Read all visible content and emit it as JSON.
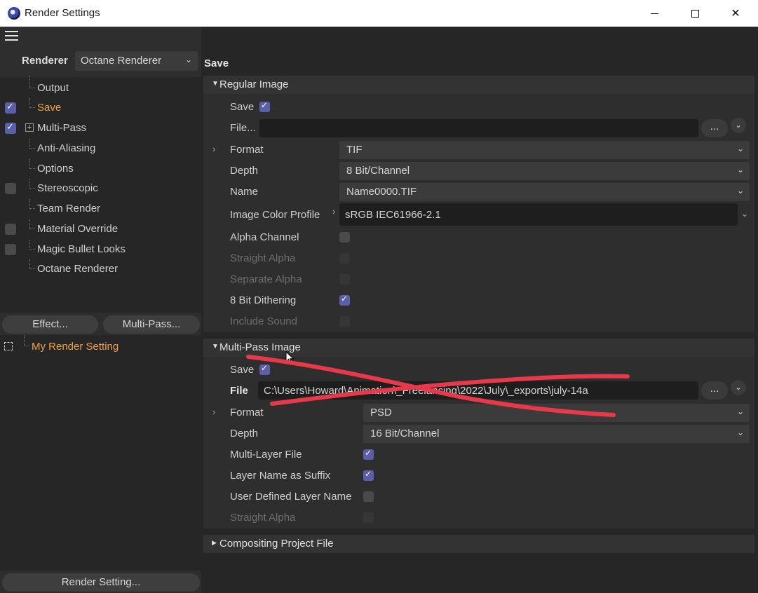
{
  "window": {
    "title": "Render Settings",
    "icon": "cinema4d-app-icon"
  },
  "renderer": {
    "label": "Renderer",
    "value": "Octane Renderer"
  },
  "tree": [
    {
      "label": "Output",
      "checkbox": "none",
      "active": false
    },
    {
      "label": "Save",
      "checkbox": "checked",
      "active": true
    },
    {
      "label": "Multi-Pass",
      "checkbox": "checked",
      "active": false,
      "expandable": true
    },
    {
      "label": "Anti-Aliasing",
      "checkbox": "none",
      "active": false
    },
    {
      "label": "Options",
      "checkbox": "none",
      "active": false
    },
    {
      "label": "Stereoscopic",
      "checkbox": "unchecked",
      "active": false
    },
    {
      "label": "Team Render",
      "checkbox": "none",
      "active": false
    },
    {
      "label": "Material Override",
      "checkbox": "unchecked",
      "active": false
    },
    {
      "label": "Magic Bullet Looks",
      "checkbox": "unchecked",
      "active": false
    },
    {
      "label": "Octane Renderer",
      "checkbox": "none",
      "active": false
    }
  ],
  "buttons": {
    "effect": "Effect...",
    "multipass": "Multi-Pass...",
    "render_setting": "Render Setting..."
  },
  "render_settings_list": [
    "My Render Setting"
  ],
  "page_title": "Save",
  "regular_image": {
    "title": "Regular Image",
    "save_label": "Save",
    "save_checked": true,
    "file_label": "File...",
    "file_value": "",
    "dots": "...",
    "format_label": "Format",
    "format_value": "TIF",
    "depth_label": "Depth",
    "depth_value": "8 Bit/Channel",
    "name_label": "Name",
    "name_value": "Name0000.TIF",
    "color_profile_label": "Image Color Profile",
    "color_profile_value": "sRGB IEC61966-2.1",
    "alpha_channel_label": "Alpha Channel",
    "straight_alpha_label": "Straight Alpha",
    "separate_alpha_label": "Separate Alpha",
    "dithering_label": "8 Bit Dithering",
    "include_sound_label": "Include Sound"
  },
  "multipass_image": {
    "title": "Multi-Pass Image",
    "save_label": "Save",
    "file_label": "File",
    "file_value": "C:\\Users\\Howard\\Animation\\_Freelancing\\2022\\July\\_exports\\july-14a",
    "dots": "...",
    "format_label": "Format",
    "format_value": "PSD",
    "depth_label": "Depth",
    "depth_value": "16 Bit/Channel",
    "multilayer_label": "Multi-Layer File",
    "layer_suffix_label": "Layer Name as Suffix",
    "user_layer_label": "User Defined Layer Name",
    "straight_alpha_label": "Straight Alpha"
  },
  "compositing": {
    "title": "Compositing Project File"
  },
  "colors": {
    "accent": "#f0a04a",
    "checkbox_checked": "#5a5fa8",
    "annotation": "#e8394a"
  }
}
